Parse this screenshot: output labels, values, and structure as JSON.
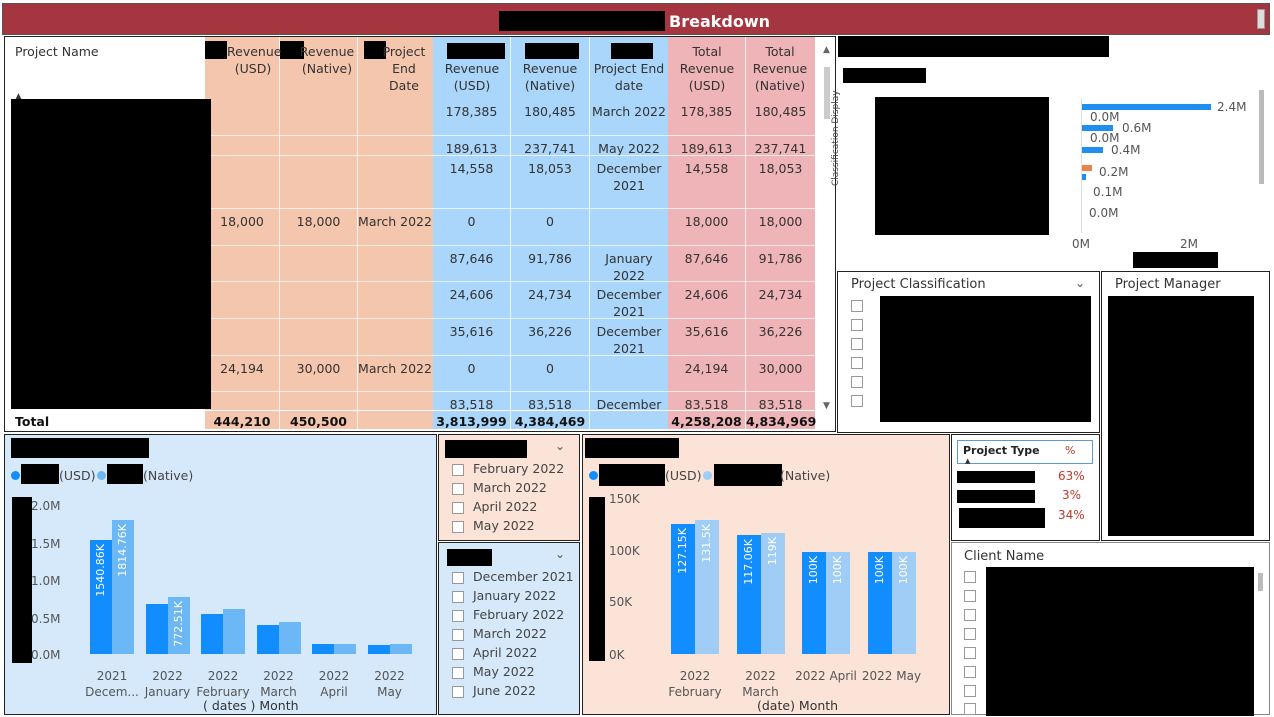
{
  "title": "Breakdown",
  "table": {
    "project_name_header": "Project Name",
    "headers_orange": [
      "Revenue (USD)",
      "Revenue (Native)",
      "Project End Date"
    ],
    "headers_blue": [
      "Revenue (USD)",
      "Revenue (Native)",
      "Project End date"
    ],
    "headers_pink": [
      "Total Revenue (USD)",
      "Total Revenue (Native)"
    ],
    "rows": [
      {
        "o1": "",
        "o2": "",
        "o3": "",
        "b1": "178,385",
        "b2": "180,485",
        "b3": "March 2022",
        "p1": "178,385",
        "p2": "180,485"
      },
      {
        "o1": "",
        "o2": "",
        "o3": "",
        "b1": "189,613",
        "b2": "237,741",
        "b3": "May 2022",
        "p1": "189,613",
        "p2": "237,741"
      },
      {
        "o1": "",
        "o2": "",
        "o3": "",
        "b1": "14,558",
        "b2": "18,053",
        "b3": "December 2021",
        "p1": "14,558",
        "p2": "18,053"
      },
      {
        "o1": "18,000",
        "o2": "18,000",
        "o3": "March 2022",
        "b1": "0",
        "b2": "0",
        "b3": "",
        "p1": "18,000",
        "p2": "18,000"
      },
      {
        "o1": "",
        "o2": "",
        "o3": "",
        "b1": "87,646",
        "b2": "91,786",
        "b3": "January 2022",
        "p1": "87,646",
        "p2": "91,786"
      },
      {
        "o1": "",
        "o2": "",
        "o3": "",
        "b1": "24,606",
        "b2": "24,734",
        "b3": "December 2021",
        "p1": "24,606",
        "p2": "24,734"
      },
      {
        "o1": "",
        "o2": "",
        "o3": "",
        "b1": "35,616",
        "b2": "36,226",
        "b3": "December 2021",
        "p1": "35,616",
        "p2": "36,226"
      },
      {
        "o1": "24,194",
        "o2": "30,000",
        "o3": "March 2022",
        "b1": "0",
        "b2": "0",
        "b3": "",
        "p1": "24,194",
        "p2": "30,000"
      },
      {
        "o1": "",
        "o2": "",
        "o3": "",
        "b1": "83,518",
        "b2": "83,518",
        "b3": "December",
        "p1": "83,518",
        "p2": "83,518"
      }
    ],
    "total": {
      "label": "Total",
      "o1": "444,210",
      "o2": "450,500",
      "b1": "3,813,999",
      "b2": "4,384,469",
      "p1": "4,258,208",
      "p2": "4,834,969"
    }
  },
  "classification_chart": {
    "ylabel": "Classification Display",
    "x_ticks": [
      "0M",
      "2M"
    ],
    "bars": [
      {
        "value": 2.4,
        "label": "2.4M",
        "color": "#1f8ef1"
      },
      {
        "value": 0.0,
        "label": "0.0M",
        "color": "#1f8ef1"
      },
      {
        "value": 0.6,
        "label": "0.6M",
        "color": "#1f8ef1"
      },
      {
        "value": 0.0,
        "label": "0.0M",
        "color": "#1f8ef1"
      },
      {
        "value": 0.4,
        "label": "0.4M",
        "color": "#1f8ef1"
      },
      {
        "value": 0.2,
        "label": "0.2M",
        "color": "#e8834a"
      },
      {
        "value": 0.1,
        "label": "0.1M",
        "color": "#1f8ef1"
      },
      {
        "value": 0.0,
        "label": "0.0M",
        "color": "#1f8ef1"
      }
    ]
  },
  "project_classification": {
    "title": "Project Classification",
    "chevron": "chevron-down-icon"
  },
  "project_manager": {
    "title": "Project Manager"
  },
  "project_type": {
    "header": "Project Type",
    "pct_header": "%",
    "values": [
      "63%",
      "3%",
      "34%"
    ]
  },
  "client_name": {
    "title": "Client Name"
  },
  "chart_data": [
    {
      "type": "bar",
      "legend": [
        "(USD)",
        "(Native)"
      ],
      "categories": [
        "2021 Decem...",
        "2022 January",
        "2022 February",
        "2022 March",
        "2022 April",
        "2022 May"
      ],
      "series": [
        {
          "name": "(USD)",
          "values": [
            1.54086,
            0.67,
            0.54,
            0.39,
            0.13,
            0.12
          ],
          "labels": [
            "1540.86K",
            "",
            "",
            "",
            "",
            ""
          ],
          "color": "#118dff"
        },
        {
          "name": "(Native)",
          "values": [
            1.81476,
            0.77251,
            0.61,
            0.43,
            0.14,
            0.13
          ],
          "labels": [
            "1814.76K",
            "772.51K",
            "",
            "",
            "",
            ""
          ],
          "color": "#6cb7f5"
        }
      ],
      "y_ticks": [
        "2.0M",
        "1.5M",
        "1.0M",
        "0.5M",
        "0.0M"
      ],
      "ylim": [
        0,
        2.0
      ],
      "xlabel": "( dates ) Month"
    },
    {
      "type": "bar",
      "legend": [
        "(USD)",
        "(Native)"
      ],
      "categories": [
        "2022 February",
        "2022 March",
        "2022 April",
        "2022 May"
      ],
      "series": [
        {
          "name": "(USD)",
          "values": [
            127.15,
            117.06,
            100,
            100
          ],
          "labels": [
            "127.15K",
            "117.06K",
            "100K",
            "100K"
          ],
          "color": "#118dff"
        },
        {
          "name": "(Native)",
          "values": [
            131.5,
            119,
            100,
            100
          ],
          "labels": [
            "131.5K",
            "119K",
            "100K",
            "100K"
          ],
          "color": "#9fcdf5"
        }
      ],
      "y_ticks": [
        "150K",
        "100K",
        "50K",
        "0K"
      ],
      "ylim": [
        0,
        150
      ],
      "xlabel": "(date) Month"
    }
  ],
  "filter_a": {
    "items": [
      "February 2022",
      "March 2022",
      "April 2022",
      "May 2022"
    ]
  },
  "filter_b": {
    "items": [
      "December 2021",
      "January 2022",
      "February 2022",
      "March 2022",
      "April 2022",
      "May 2022",
      "June 2022"
    ]
  },
  "colors": {
    "title_bg": "#a5353f",
    "orange": "#f5c6ae",
    "blue": "#a9d6fa",
    "pink": "#efb4b8",
    "panel_blue": "#d6e9fb",
    "panel_peach": "#fbe3d8"
  }
}
